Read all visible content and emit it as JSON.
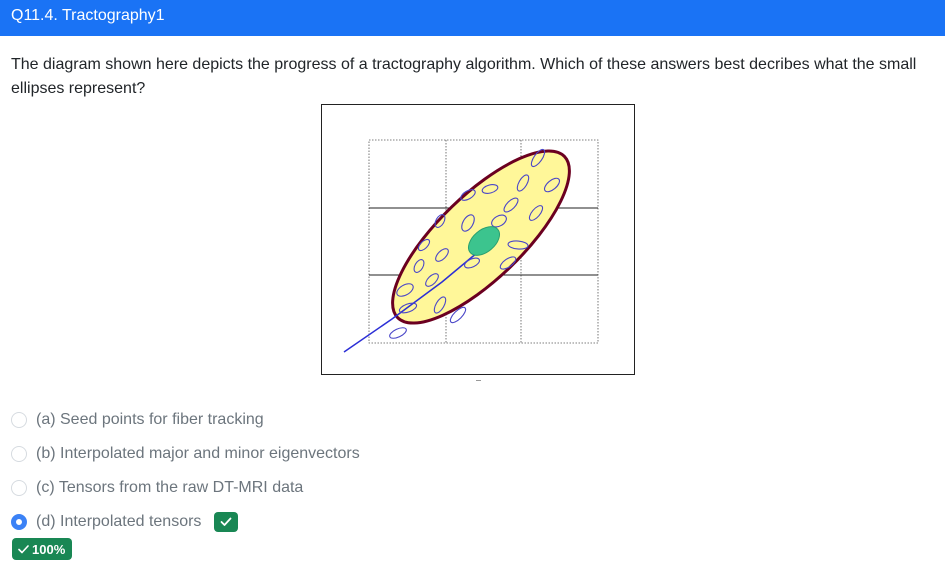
{
  "header": {
    "title": "Q11.4. Tractography1",
    "color": "#1a73f5"
  },
  "question": {
    "text": "The diagram shown here depicts the progress of a tractography algorithm. Which of these answers best decribes what the small ellipses represent?"
  },
  "figure": {
    "icon": "tractography-diagram",
    "fill_color": "#fff799",
    "outline_color": "#6b0020",
    "center_ellipse_color": "#3cc48e",
    "small_ellipse_color": "#4a46c8",
    "fiber_line_color": "#2c2fd6"
  },
  "options": [
    {
      "label": "(a) Seed points for fiber tracking",
      "selected": false
    },
    {
      "label": "(b) Interpolated major and minor eigenvectors",
      "selected": false
    },
    {
      "label": "(c) Tensors from the raw DT-MRI data",
      "selected": false
    },
    {
      "label": "(d) Interpolated tensors",
      "selected": true,
      "correct": true
    }
  ],
  "score": {
    "label": "100%",
    "icon": "checkmark-icon",
    "color": "#198754"
  }
}
